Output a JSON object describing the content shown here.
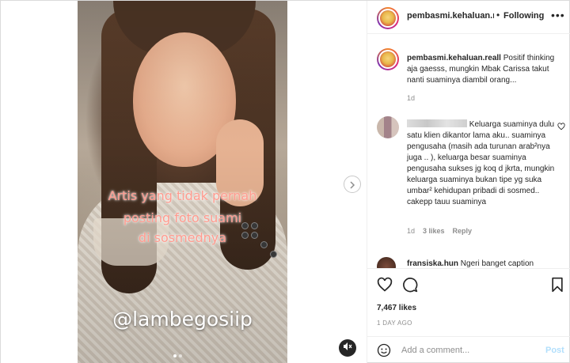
{
  "header": {
    "username": "pembasmi.kehaluan.re",
    "separator": "•",
    "follow_label": "Following",
    "more": "•••"
  },
  "media": {
    "overlay_line1": "Artis yang tidak pernah",
    "overlay_line2": "posting foto suami",
    "overlay_line3": "di sosmednya",
    "handle": "@lambegosiip",
    "next_icon": "chevron-right-icon",
    "mute_icon": "muted-speaker-icon",
    "dots": [
      true,
      false
    ]
  },
  "caption": {
    "username": "pembasmi.kehaluan.reall",
    "text": " Positif thinking aja gaesss, mungkin Mbak Carissa takut nanti suaminya diambil orang...",
    "time": "1d"
  },
  "comment": {
    "text": " Keluarga suaminya dulu satu klien dikantor lama aku.. suaminya pengusaha (masih ada turunan arab²nya juga .. ), keluarga besar suaminya pengusaha sukses jg koq d jkrta, mungkin keluarga suaminya bukan tipe yg suka umbar² kehidupan pribadi di sosmed.. cakepp tauu suaminya",
    "time": "1d",
    "likes": "3 likes",
    "reply": "Reply",
    "heart_icon": "heart-icon"
  },
  "comment2": {
    "username": "fransiska.hun",
    "text": " Ngeri banget caption"
  },
  "actions": {
    "likes": "7,467 likes",
    "time": "1 DAY AGO"
  },
  "add_comment": {
    "placeholder": "Add a comment...",
    "post_label": "Post"
  }
}
